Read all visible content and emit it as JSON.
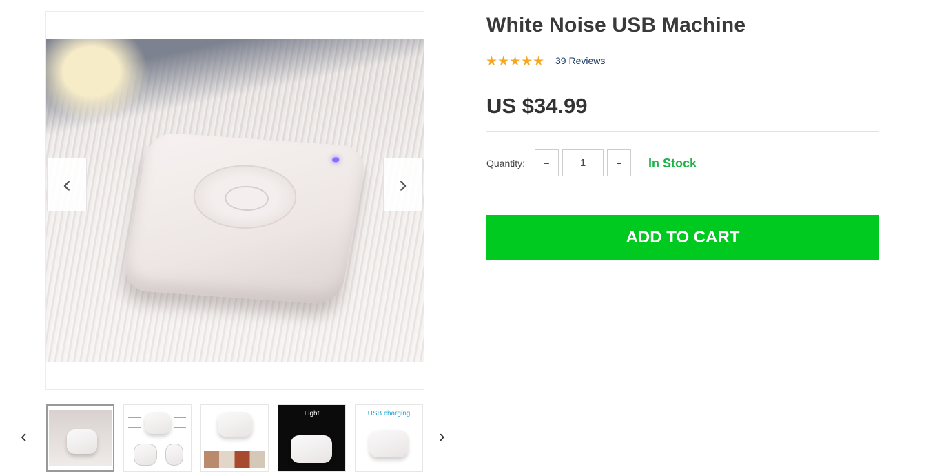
{
  "product": {
    "title": "White Noise USB Machine",
    "rating": 5,
    "stars": "★★★★★",
    "reviews_label": "39 Reviews",
    "price": "US $34.99"
  },
  "purchase": {
    "quantity_label": "Quantity:",
    "quantity_value": "1",
    "minus_label": "−",
    "plus_label": "+",
    "stock_status": "In Stock",
    "add_to_cart_label": "ADD TO CART"
  },
  "gallery": {
    "prev_arrow": "‹",
    "next_arrow": "›",
    "thumb_prev": "‹",
    "thumb_next": "›",
    "thumbnails": [
      {
        "caption": ""
      },
      {
        "caption": ""
      },
      {
        "caption": ""
      },
      {
        "caption": "Light"
      },
      {
        "caption": "USB charging"
      }
    ]
  },
  "colors": {
    "accent": "#00c91f",
    "in_stock": "#21b24a",
    "stars": "#f5a623",
    "link": "#1a3a66"
  }
}
